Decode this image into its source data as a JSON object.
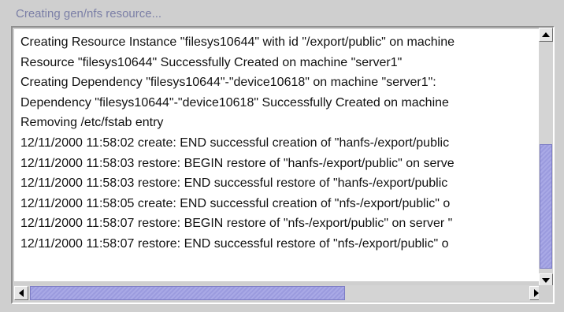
{
  "panel": {
    "title": "Creating gen/nfs resource..."
  },
  "log": {
    "lines": [
      "Creating Resource Instance \"filesys10644\" with id \"/export/public\" on machine",
      "Resource \"filesys10644\" Successfully Created on machine \"server1\"",
      "Creating Dependency \"filesys10644\"-\"device10618\" on machine \"server1\":",
      "Dependency \"filesys10644\"-\"device10618\" Successfully Created on machine",
      "Removing /etc/fstab entry",
      "12/11/2000 11:58:02 create: END successful creation of \"hanfs-/export/public",
      "12/11/2000 11:58:03 restore: BEGIN restore of \"hanfs-/export/public\" on serve",
      "12/11/2000 11:58:03 restore: END successful restore of \"hanfs-/export/public",
      "12/11/2000 11:58:05 create: END successful creation of \"nfs-/export/public\" o",
      "12/11/2000 11:58:07 restore: BEGIN restore of \"nfs-/export/public\" on server \"",
      "12/11/2000 11:58:07 restore: END successful restore of \"nfs-/export/public\" o"
    ]
  },
  "scrollbars": {
    "vertical_position": 0.62,
    "horizontal_position": 0.0
  },
  "icons": {
    "scroll_up": "arrow-up-icon",
    "scroll_down": "arrow-down-icon",
    "scroll_left": "arrow-left-icon",
    "scroll_right": "arrow-right-icon"
  },
  "colors": {
    "title_text": "#7b7fa6",
    "scroll_thumb": "#a9a9e6",
    "panel_bg": "#cfcfcf"
  }
}
